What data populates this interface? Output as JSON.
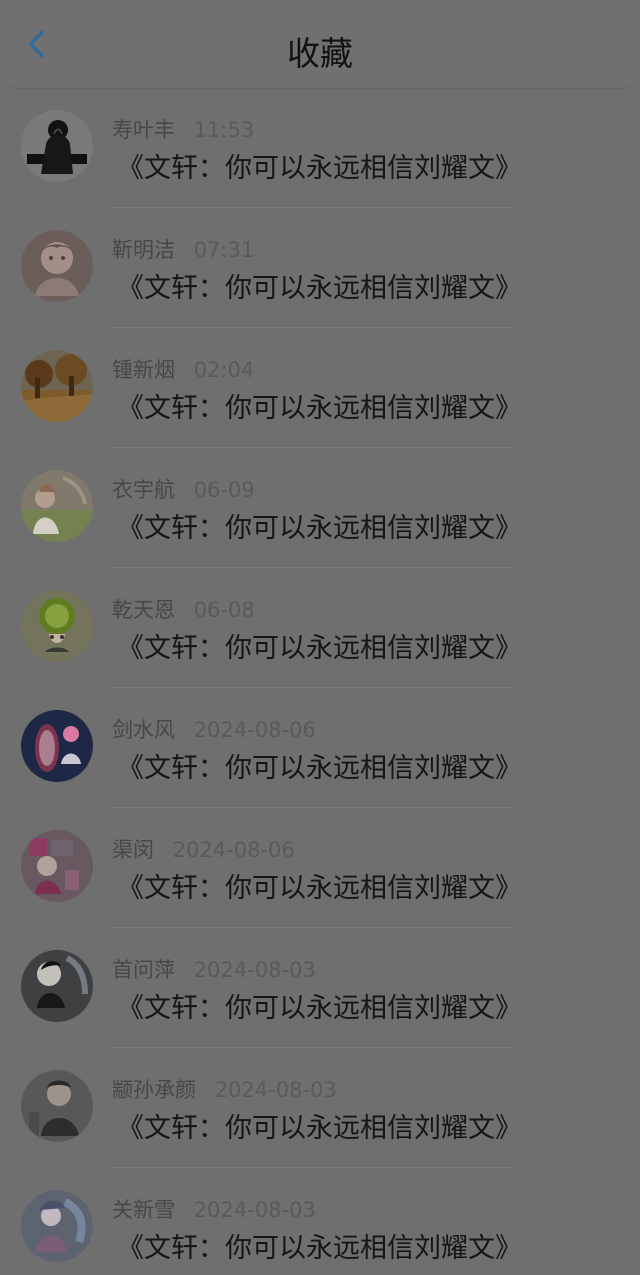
{
  "header": {
    "title": "收藏",
    "back_icon": "chevron-left-icon",
    "accent_color": "#2f6aa0"
  },
  "list": {
    "items": [
      {
        "name": "寿叶丰",
        "time": "11:53",
        "content": "《文轩：你可以永远相信刘耀文》",
        "avatar_icon": "avatar-portrait-icon"
      },
      {
        "name": "靳明洁",
        "time": "07:31",
        "content": "《文轩：你可以永远相信刘耀文》",
        "avatar_icon": "avatar-portrait-icon"
      },
      {
        "name": "锺新烟",
        "time": "02:04",
        "content": "《文轩：你可以永远相信刘耀文》",
        "avatar_icon": "avatar-landscape-icon"
      },
      {
        "name": "衣宇航",
        "time": "06-09",
        "content": "《文轩：你可以永远相信刘耀文》",
        "avatar_icon": "avatar-portrait-icon"
      },
      {
        "name": "乾天恩",
        "time": "06-08",
        "content": "《文轩：你可以永远相信刘耀文》",
        "avatar_icon": "avatar-character-icon"
      },
      {
        "name": "剑水风",
        "time": "2024-08-06",
        "content": "《文轩：你可以永远相信刘耀文》",
        "avatar_icon": "avatar-illustration-icon"
      },
      {
        "name": "渠闵",
        "time": "2024-08-06",
        "content": "《文轩：你可以永远相信刘耀文》",
        "avatar_icon": "avatar-photo-icon"
      },
      {
        "name": "首问萍",
        "time": "2024-08-03",
        "content": "《文轩：你可以永远相信刘耀文》",
        "avatar_icon": "avatar-portrait-icon"
      },
      {
        "name": "颛孙承颜",
        "time": "2024-08-03",
        "content": "《文轩：你可以永远相信刘耀文》",
        "avatar_icon": "avatar-portrait-icon"
      },
      {
        "name": "关新雪",
        "time": "2024-08-03",
        "content": "《文轩：你可以永远相信刘耀文》",
        "avatar_icon": "avatar-illustration-icon"
      }
    ]
  }
}
